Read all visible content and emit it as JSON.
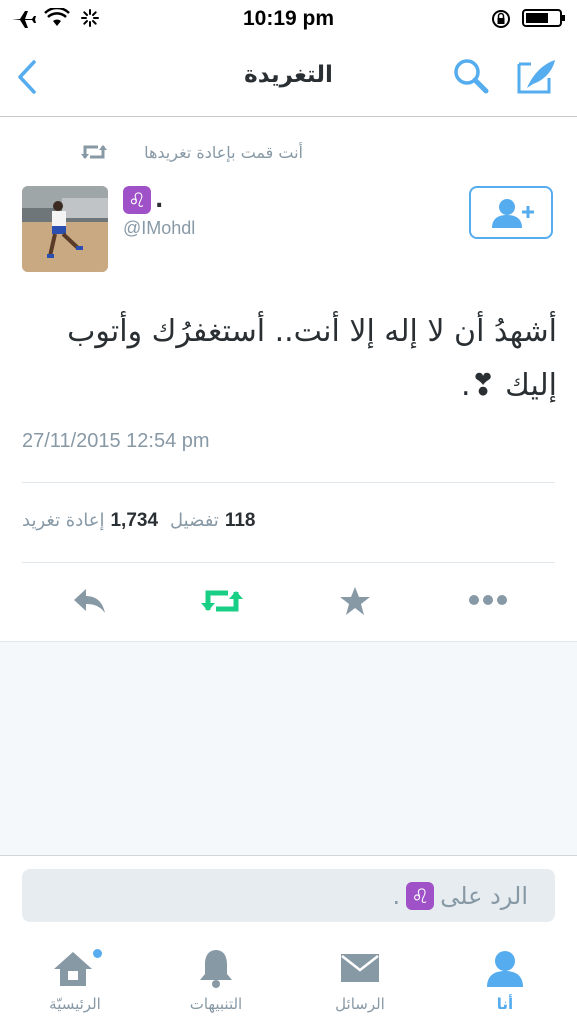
{
  "status_bar": {
    "time": "10:19 pm"
  },
  "nav": {
    "title": "التغريدة"
  },
  "tweet": {
    "retweet_label": "أنت قمت بإعادة تغريدها",
    "name_suffix": ".",
    "zodiac_glyph": "♌",
    "handle": "@IMohdl",
    "text": "أشهدُ أن لا إله إلا أنت.. أستغفرُك وأتوب إليك ❣.",
    "timestamp": "27/11/2015 12:54 pm",
    "retweet_count": "1,734",
    "retweet_word": "إعادة تغريد",
    "like_count": "118",
    "like_word": "تفضيل"
  },
  "reply": {
    "placeholder": "الرد على",
    "trailing": "."
  },
  "tabs": [
    {
      "label": "الرئيسيّة"
    },
    {
      "label": "التنبيهات"
    },
    {
      "label": "الرسائل"
    },
    {
      "label": "أنا"
    }
  ],
  "colors": {
    "accent": "#55acee",
    "retweet_green": "#19cf86",
    "muted": "#8899a6"
  }
}
